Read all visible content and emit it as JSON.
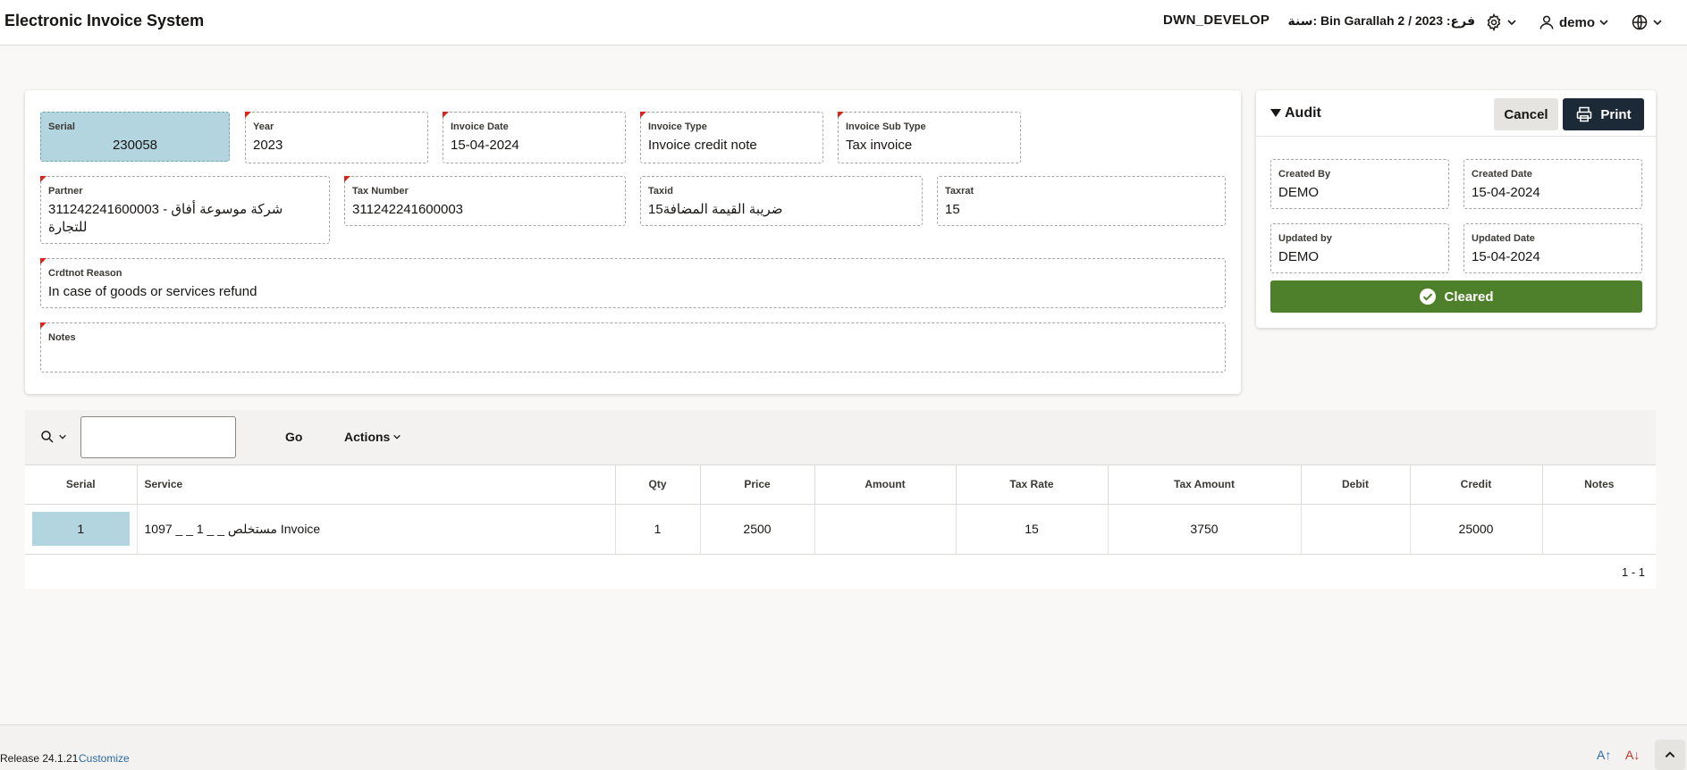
{
  "app": {
    "title": "Electronic Invoice System"
  },
  "header": {
    "environment": "DWN_DEVELOP",
    "branch": "فرع: Bin Garallah 2 / 2023 :سنة",
    "user": "demo"
  },
  "form": {
    "serial": {
      "label": "Serial",
      "value": "230058"
    },
    "year": {
      "label": "Year",
      "value": "2023"
    },
    "invoice_date": {
      "label": "Invoice Date",
      "value": "15-04-2024"
    },
    "invoice_type": {
      "label": "Invoice Type",
      "value": "Invoice credit note"
    },
    "invoice_sub_type": {
      "label": "Invoice Sub Type",
      "value": "Tax invoice"
    },
    "partner": {
      "label": "Partner",
      "value": "311242241600003 - شركة موسوعة أفاق للتجارة"
    },
    "tax_number": {
      "label": "Tax Number",
      "value": "311242241600003"
    },
    "taxid": {
      "label": "Taxid",
      "value": "15ضريبة القيمة المضافة"
    },
    "taxrat": {
      "label": "Taxrat",
      "value": "15"
    },
    "crdtnot_reason": {
      "label": "Crdtnot Reason",
      "value": "In case of goods or services refund"
    },
    "notes": {
      "label": "Notes",
      "value": ""
    }
  },
  "audit": {
    "title": "Audit",
    "cancel_label": "Cancel",
    "print_label": "Print",
    "created_by": {
      "label": "Created By",
      "value": "DEMO"
    },
    "created_date": {
      "label": "Created Date",
      "value": "15-04-2024"
    },
    "updated_by": {
      "label": "Updated by",
      "value": "DEMO"
    },
    "updated_date": {
      "label": "Updated Date",
      "value": "15-04-2024"
    },
    "status": "Cleared",
    "status_color": "#4e7f2a"
  },
  "grid": {
    "go_label": "Go",
    "actions_label": "Actions",
    "search_value": "",
    "columns": [
      "Serial",
      "Service",
      "Qty",
      "Price",
      "Amount",
      "Tax Rate",
      "Tax Amount",
      "Debit",
      "Credit",
      "Notes"
    ],
    "rows": [
      {
        "serial": "1",
        "service": "1097 _ _ 1 _ _ مستخلص Invoice",
        "qty": "1",
        "price": "2500",
        "amount": "",
        "tax_rate": "15",
        "tax_amount": "3750",
        "debit": "",
        "credit": "25000",
        "notes": ""
      }
    ],
    "pagination": "1 - 1"
  },
  "footer": {
    "release": "Release 24.1.21",
    "customize": "Customize"
  },
  "colors": {
    "brand_dark": "#1c2a38",
    "highlight": "#b3d5e0",
    "required": "#d6271c"
  }
}
